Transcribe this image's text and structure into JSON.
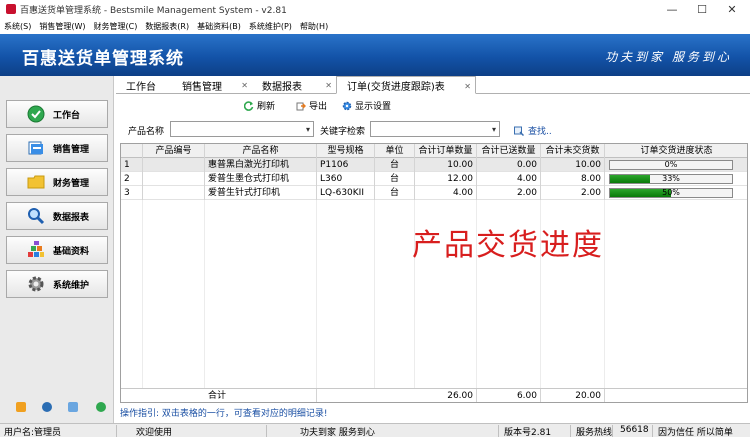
{
  "window": {
    "title": "百惠送货单管理系统 - Bestsmile Management System - v2.81"
  },
  "menu": [
    "系统(S)",
    "销售管理(W)",
    "财务管理(C)",
    "数据报表(R)",
    "基础资料(B)",
    "系统维护(P)",
    "帮助(H)"
  ],
  "banner": {
    "name": "百惠送货单管理系统",
    "slogan": "功夫到家 服务到心"
  },
  "sidebar": {
    "items": [
      {
        "label": "工作台",
        "icon": "check-circle-icon"
      },
      {
        "label": "销售管理",
        "icon": "sales-document-icon"
      },
      {
        "label": "财务管理",
        "icon": "folder-icon"
      },
      {
        "label": "数据报表",
        "icon": "magnifier-icon"
      },
      {
        "label": "基础资料",
        "icon": "building-blocks-icon"
      },
      {
        "label": "系统维护",
        "icon": "gear-icon"
      }
    ]
  },
  "tabs": [
    {
      "label": "工作台",
      "closable": false
    },
    {
      "label": "销售管理",
      "closable": true
    },
    {
      "label": "数据报表",
      "closable": true
    },
    {
      "label": "订单(交货进度跟踪)表",
      "closable": true,
      "active": true
    }
  ],
  "toolbar": {
    "refresh": "刷新",
    "export": "导出",
    "display_settings": "显示设置"
  },
  "filters": {
    "product_name_label": "产品名称",
    "product_name_value": "",
    "keyword_label": "关键字检索",
    "keyword_value": "",
    "search_label": "查找.."
  },
  "grid": {
    "columns": [
      "",
      "产品编号",
      "产品名称",
      "型号规格",
      "单位",
      "合计订单数量",
      "合计已送数量",
      "合计未交货数",
      "订单交货进度状态"
    ],
    "rows": [
      {
        "no": "1",
        "code": "",
        "name": "惠普黑白激光打印机",
        "model": "P1106",
        "unit": "台",
        "ordered": "10.00",
        "delivered": "0.00",
        "pending": "10.00",
        "progress_text": "0%",
        "progress": 0
      },
      {
        "no": "2",
        "code": "",
        "name": "爱普生墨仓式打印机",
        "model": "L360",
        "unit": "台",
        "ordered": "12.00",
        "delivered": "4.00",
        "pending": "8.00",
        "progress_text": "33%",
        "progress": 33
      },
      {
        "no": "3",
        "code": "",
        "name": "爱普生针式打印机",
        "model": "LQ-630KII",
        "unit": "台",
        "ordered": "4.00",
        "delivered": "2.00",
        "pending": "2.00",
        "progress_text": "50%",
        "progress": 50
      }
    ],
    "total": {
      "label": "合计",
      "ordered": "26.00",
      "delivered": "6.00",
      "pending": "20.00"
    }
  },
  "overlay_text": "产品交货进度",
  "hint": "操作指引: 双击表格的一行，可查看对应的明细记录!",
  "status": {
    "user": "用户名:管理员",
    "welcome": "欢迎使用",
    "slogan": "功夫到家 服务到心",
    "version": "版本号2.81",
    "service": "服务热线",
    "number": "56618",
    "tagline": "因为信任 所以简单"
  },
  "colors": {
    "banner": "#1353a8",
    "progress_fill": "#0a7a0a",
    "overlay": "#d81e1e",
    "link": "#1a4fa3"
  }
}
